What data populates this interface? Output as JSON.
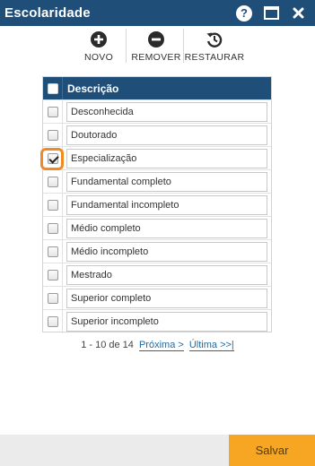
{
  "window": {
    "title": "Escolaridade",
    "icons": [
      "help-icon",
      "maximize-icon",
      "close-icon"
    ]
  },
  "toolbar": {
    "new_label": "NOVO",
    "remove_label": "REMOVER",
    "restore_label": "RESTAURAR"
  },
  "grid": {
    "header": "Descrição",
    "rows": [
      {
        "label": "Desconhecida",
        "checked": false
      },
      {
        "label": "Doutorado",
        "checked": false
      },
      {
        "label": "Especialização",
        "checked": true
      },
      {
        "label": "Fundamental completo",
        "checked": false
      },
      {
        "label": "Fundamental incompleto",
        "checked": false
      },
      {
        "label": "Médio completo",
        "checked": false
      },
      {
        "label": "Médio incompleto",
        "checked": false
      },
      {
        "label": "Mestrado",
        "checked": false
      },
      {
        "label": "Superior completo",
        "checked": false
      },
      {
        "label": "Superior incompleto",
        "checked": false
      }
    ]
  },
  "pager": {
    "range": "1 - 10 de 14",
    "next_label": "Próxima >",
    "last_label": "Última >>|"
  },
  "footer": {
    "save_label": "Salvar"
  },
  "colors": {
    "titlebar": "#1f4e79",
    "accent_save": "#f6a623",
    "highlight": "#f08a24"
  }
}
